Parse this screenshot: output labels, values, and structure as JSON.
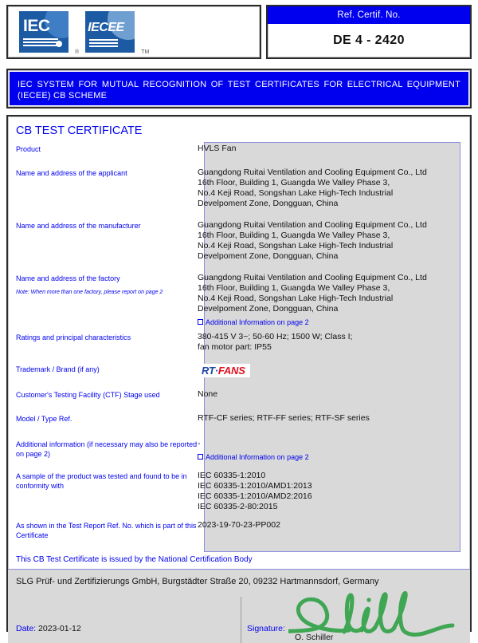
{
  "header": {
    "iec_logo_text": "IEC",
    "iecee_logo_text": "IECEE",
    "registered_mark": "®",
    "trademark_mark": "TM",
    "ref_label": "Ref. Certif. No.",
    "ref_value": "DE 4 - 2420"
  },
  "banner": {
    "line1": "IEC SYSTEM FOR MUTUAL RECOGNITION OF TEST CERTIFICATES FOR ELECTRICAL EQUIPMENT",
    "line2": "(IECEE) CB SCHEME"
  },
  "certificate": {
    "title": "CB TEST CERTIFICATE",
    "rows": [
      {
        "label": "Product",
        "value": "HVLS Fan"
      },
      {
        "label": "Name and address of the applicant",
        "value": "Guangdong Ruitai Ventilation and Cooling Equipment Co., Ltd\n16th Floor, Building 1, Guangda We Valley Phase 3,\nNo.4 Keji Road, Songshan Lake High-Tech Industrial\nDevelpoment Zone, Dongguan, China"
      },
      {
        "label": "Name and address of the manufacturer",
        "value": "Guangdong Ruitai Ventilation and Cooling Equipment Co., Ltd\n16th Floor, Building 1, Guangda We Valley Phase 3,\nNo.4 Keji Road, Songshan Lake High-Tech Industrial\nDevelpoment Zone, Dongguan, China"
      },
      {
        "label": "Name and address of the factory",
        "note": "Note: When more than one factory, please report on page 2",
        "value": "Guangdong Ruitai Ventilation and Cooling Equipment Co., Ltd\n16th Floor, Building 1, Guangda We Valley Phase 3,\nNo.4 Keji Road, Songshan Lake High-Tech Industrial\nDevelpoment Zone, Dongguan, China",
        "checkbox_label": "Additional Information on page 2"
      },
      {
        "label": "Ratings and principal characteristics",
        "value": "380-415 V 3~; 50-60 Hz; 1500 W; Class I;\nfan motor part: IP55"
      },
      {
        "label": "Trademark / Brand (if any)",
        "brand": {
          "prefix": "RT",
          "separator": "·",
          "suffix": "FANS"
        }
      },
      {
        "label": "Customer's Testing Facility (CTF) Stage used",
        "value": "None"
      },
      {
        "label": "Model / Type Ref.",
        "value": "RTF-CF series; RTF-FF series; RTF-SF series"
      },
      {
        "label": "Additional information (if necessary may also be reported on page 2)",
        "value": "-",
        "checkbox_label": "Additional Information on page 2"
      },
      {
        "label": "A sample of the product was tested and found to be in conformity with",
        "value": "IEC 60335-1:2010\nIEC 60335-1:2010/AMD1:2013\nIEC 60335-1:2010/AMD2:2016\nIEC 60335-2-80:2015"
      },
      {
        "label": "As shown in the Test Report Ref. No. which is part of this Certificate",
        "value": "2023-19-70-23-PP002"
      }
    ],
    "ncb_issued_by": "This CB Test Certificate is issued by the National Certification Body",
    "ncb_name": "SLG Prüf- und Zertifizierungs GmbH, Burgstädter Straße 20, 09232 Hartmannsdorf, Germany",
    "date_label": "Date:",
    "date_value": "2023-01-12",
    "signature_label": "Signature:",
    "signatory_name": "O. Schiller"
  },
  "colors": {
    "blue_text": "#0000ee",
    "banner_bg": "#0000ee",
    "value_bg": "#d9d9d9",
    "value_border": "#8d8de0",
    "brand_blue": "#1b44a6",
    "brand_red": "#e01020",
    "signature_green": "#3fa653",
    "logo_blue": "#1c5ba4"
  }
}
